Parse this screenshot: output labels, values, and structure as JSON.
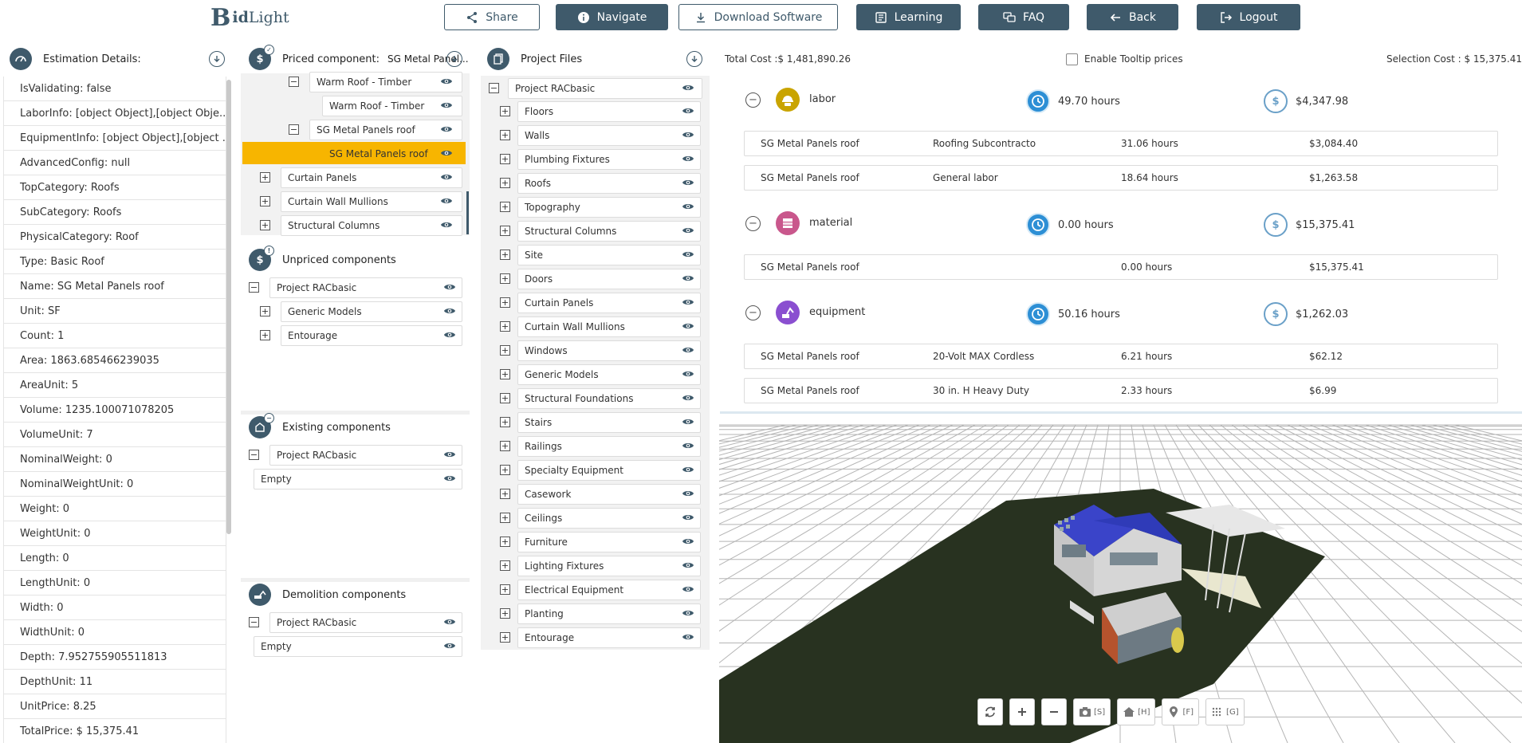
{
  "app": {
    "logo_b": "B",
    "logo_id": "id",
    "logo_light": "Light"
  },
  "toolbar": {
    "share": "Share",
    "navigate": "Navigate",
    "download": "Download Software",
    "learning": "Learning",
    "faq": "FAQ",
    "back": "Back",
    "logout": "Logout"
  },
  "estimation": {
    "title": "Estimation Details:",
    "rows": [
      "IsValidating: false",
      "LaborInfo: [object Object],[object Obje...",
      "EquipmentInfo: [object Object],[object ...",
      "AdvancedConfig: null",
      "TopCategory: Roofs",
      "SubCategory: Roofs",
      "PhysicalCategory: Roof",
      "Type: Basic Roof",
      "Name: SG Metal Panels roof",
      "Unit: SF",
      "Count: 1",
      "Area: 1863.685466239035",
      "AreaUnit: 5",
      "Volume: 1235.100071078205",
      "VolumeUnit: 7",
      "NominalWeight: 0",
      "NominalWeightUnit: 0",
      "Weight: 0",
      "WeightUnit: 0",
      "Length: 0",
      "LengthUnit: 0",
      "Width: 0",
      "WidthUnit: 0",
      "Depth: 7.952755905511813",
      "DepthUnit: 11",
      "UnitPrice: 8.25",
      "TotalPrice: $ 15,375.41"
    ]
  },
  "priced": {
    "title": "Priced component:",
    "subtitle": "SG Metal Panel...",
    "rows": [
      {
        "label": "Warm Roof - Timber",
        "box": "−"
      },
      {
        "label": "Warm Roof - Timber",
        "box": ""
      },
      {
        "label": "SG Metal Panels roof",
        "box": "−"
      },
      {
        "label": "SG Metal Panels roof",
        "box": ""
      },
      {
        "label": "Curtain Panels",
        "box": "+"
      },
      {
        "label": "Curtain Wall Mullions",
        "box": "+"
      },
      {
        "label": "Structural Columns",
        "box": "+"
      }
    ]
  },
  "unpriced": {
    "title": "Unpriced components",
    "rows": [
      {
        "label": "Project RACbasic",
        "box": "−"
      },
      {
        "label": "Generic Models",
        "box": "+"
      },
      {
        "label": "Entourage",
        "box": "+"
      }
    ]
  },
  "existing": {
    "title": "Existing components",
    "rows": [
      {
        "label": "Project RACbasic",
        "box": "−"
      },
      {
        "label": "Empty",
        "box": ""
      }
    ]
  },
  "demolition": {
    "title": "Demolition components",
    "rows": [
      {
        "label": "Project RACbasic",
        "box": "−"
      },
      {
        "label": "Empty",
        "box": ""
      }
    ]
  },
  "project_files": {
    "title": "Project Files",
    "root": "Project RACbasic",
    "items": [
      "Floors",
      "Walls",
      "Plumbing Fixtures",
      "Roofs",
      "Topography",
      "Structural Columns",
      "Site",
      "Doors",
      "Curtain Panels",
      "Curtain Wall Mullions",
      "Windows",
      "Generic Models",
      "Structural Foundations",
      "Stairs",
      "Railings",
      "Specialty Equipment",
      "Casework",
      "Ceilings",
      "Furniture",
      "Lighting Fixtures",
      "Electrical Equipment",
      "Planting",
      "Entourage"
    ]
  },
  "costs": {
    "total_cost": "Total Cost :$ 1,481,890.26",
    "tooltip_label": "Enable Tooltip prices",
    "selection_cost": "Selection Cost : $ 15,375.41",
    "categories": [
      {
        "name": "labor",
        "hours": "49.70 hours",
        "amount": "$4,347.98",
        "color": "#c9a400",
        "lines": [
          {
            "item": "SG Metal Panels roof",
            "resource": "Roofing Subcontracto",
            "hours": "31.06 hours",
            "amount": "$3,084.40"
          },
          {
            "item": "SG Metal Panels roof",
            "resource": "General labor",
            "hours": "18.64 hours",
            "amount": "$1,263.58"
          }
        ]
      },
      {
        "name": "material",
        "hours": "0.00 hours",
        "amount": "$15,375.41",
        "color": "#c9578c",
        "lines": [
          {
            "item": "SG Metal Panels roof",
            "resource": "",
            "hours": "0.00 hours",
            "amount": "$15,375.41"
          }
        ]
      },
      {
        "name": "equipment",
        "hours": "50.16 hours",
        "amount": "$1,262.03",
        "color": "#8a4fd0",
        "lines": [
          {
            "item": "SG Metal Panels roof",
            "resource": "20-Volt MAX Cordless",
            "hours": "6.21 hours",
            "amount": "$62.12"
          },
          {
            "item": "SG Metal Panels roof",
            "resource": "30 in. H Heavy Duty",
            "hours": "2.33 hours",
            "amount": "$6.99"
          }
        ]
      }
    ]
  },
  "viewer_tools": {
    "screenshot": "[S]",
    "home": "[H]",
    "focus": "[F]",
    "grid": "[G]"
  }
}
